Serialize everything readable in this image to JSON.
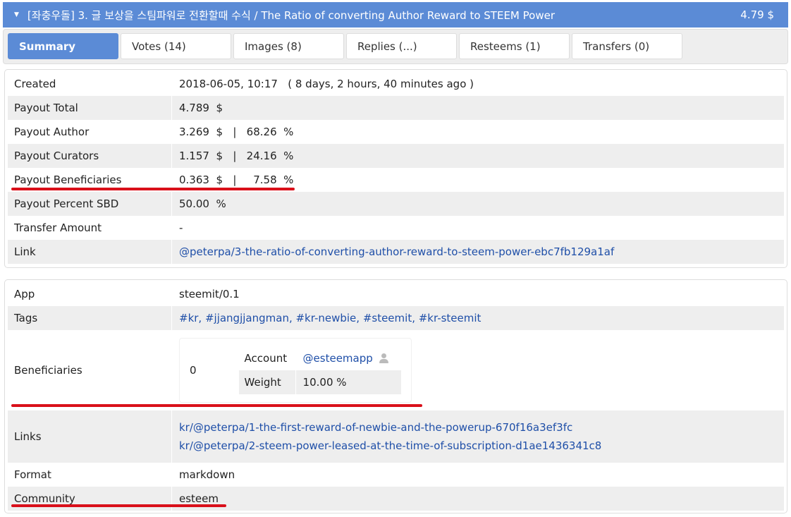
{
  "header": {
    "title": "[좌충우돌] 3. 글 보상을 스팀파워로 전환할때 수식 / The Ratio of converting Author Reward to STEEM Power",
    "amount": "4.79 $"
  },
  "tabs": [
    "Summary",
    "Votes (14)",
    "Images (8)",
    "Replies (...)",
    "Resteems (1)",
    "Transfers (0)"
  ],
  "summary": [
    {
      "label": "Created",
      "value": "2018-06-05, 10:17   ( 8 days, 2 hours, 40 minutes ago )"
    },
    {
      "label": "Payout Total",
      "value": "4.789  $"
    },
    {
      "label": "Payout Author",
      "value": "3.269  $   |   68.26  %"
    },
    {
      "label": "Payout Curators",
      "value": "1.157  $   |   24.16  %"
    },
    {
      "label": "Payout Beneficiaries",
      "value": "0.363  $   |     7.58  %"
    },
    {
      "label": "Payout Percent SBD",
      "value": "50.00  %"
    },
    {
      "label": "Transfer Amount",
      "value": "-"
    },
    {
      "label": "Link",
      "value": "@peterpa/3-the-ratio-of-converting-author-reward-to-steem-power-ebc7fb129a1af"
    }
  ],
  "details": {
    "app_label": "App",
    "app": "steemit/0.1",
    "tags_label": "Tags",
    "tags": "#kr, #jjangjjangman, #kr-newbie, #steemit, #kr-steemit",
    "ben_label": "Beneficiaries",
    "ben_index": "0",
    "account_label": "Account",
    "account": "@esteemapp",
    "weight_label": "Weight",
    "weight": "10.00 %",
    "links_label": "Links",
    "links": [
      "kr/@peterpa/1-the-first-reward-of-newbie-and-the-powerup-670f16a3ef3fc",
      "kr/@peterpa/2-steem-power-leased-at-the-time-of-subscription-d1ae1436341c8"
    ],
    "format_label": "Format",
    "format": "markdown",
    "community_label": "Community",
    "community": "esteem"
  }
}
